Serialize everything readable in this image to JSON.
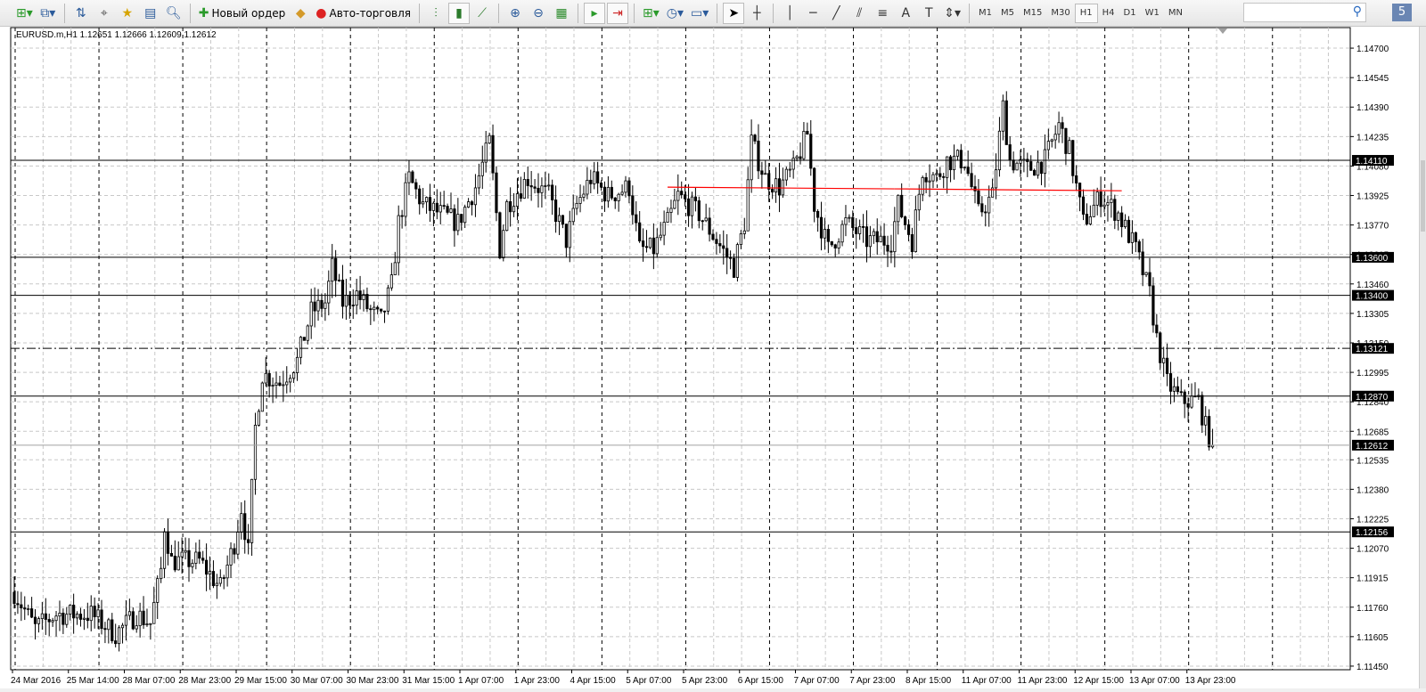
{
  "toolbar": {
    "new_order": "Новый ордер",
    "auto_trading": "Авто-торговля",
    "timeframes": [
      "M1",
      "M5",
      "M15",
      "M30",
      "H1",
      "H4",
      "D1",
      "W1",
      "MN"
    ],
    "active_timeframe": "H1",
    "search_placeholder": "",
    "notifications": "5"
  },
  "chart_info": "EURUSD.m,H1  1.12651 1.12666 1.12609 1.12612",
  "chart_data": {
    "type": "candlestick",
    "symbol": "EURUSD.m",
    "timeframe": "H1",
    "ylim": [
      1.11431,
      1.14808
    ],
    "bars": 344,
    "y_ticks": [
      "1.14700",
      "1.14545",
      "1.14390",
      "1.14235",
      "1.14080",
      "1.13925",
      "1.13770",
      "1.13615",
      "1.13460",
      "1.13305",
      "1.13150",
      "1.12995",
      "1.12840",
      "1.12685",
      "1.12535",
      "1.12380",
      "1.12225",
      "1.12070",
      "1.11915",
      "1.11760",
      "1.11605",
      "1.11450"
    ],
    "x_labels": [
      "24 Mar 2016",
      "25 Mar 14:00",
      "28 Mar 07:00",
      "28 Mar 23:00",
      "29 Mar 15:00",
      "30 Mar 07:00",
      "30 Mar 23:00",
      "31 Mar 15:00",
      "1 Apr 07:00",
      "1 Apr 23:00",
      "4 Apr 15:00",
      "5 Apr 07:00",
      "5 Apr 23:00",
      "6 Apr 15:00",
      "7 Apr 07:00",
      "7 Apr 23:00",
      "8 Apr 15:00",
      "11 Apr 07:00",
      "11 Apr 23:00",
      "12 Apr 15:00",
      "13 Apr 07:00",
      "13 Apr 23:00"
    ],
    "close_path": [
      [
        0,
        1.11839
      ],
      [
        6,
        1.11651
      ],
      [
        12,
        1.11722
      ],
      [
        22,
        1.11722
      ],
      [
        29,
        1.11619
      ],
      [
        35,
        1.11722
      ],
      [
        39,
        1.11675
      ],
      [
        42,
        1.11956
      ],
      [
        43,
        1.1219
      ],
      [
        45,
        1.12003
      ],
      [
        53,
        1.12003
      ],
      [
        59,
        1.11862
      ],
      [
        63,
        1.12096
      ],
      [
        65,
        1.12284
      ],
      [
        67,
        1.12049
      ],
      [
        69,
        1.12705
      ],
      [
        71,
        1.12986
      ],
      [
        76,
        1.12939
      ],
      [
        81,
        1.13056
      ],
      [
        85,
        1.13314
      ],
      [
        89,
        1.13361
      ],
      [
        91,
        1.13548
      ],
      [
        94,
        1.13361
      ],
      [
        98,
        1.13407
      ],
      [
        102,
        1.13314
      ],
      [
        105,
        1.13267
      ],
      [
        108,
        1.13454
      ],
      [
        110,
        1.13782
      ],
      [
        113,
        1.14016
      ],
      [
        117,
        1.13876
      ],
      [
        122,
        1.13829
      ],
      [
        127,
        1.13782
      ],
      [
        132,
        1.13969
      ],
      [
        136,
        1.14204
      ],
      [
        139,
        1.13642
      ],
      [
        141,
        1.13876
      ],
      [
        147,
        1.14016
      ],
      [
        153,
        1.13923
      ],
      [
        158,
        1.13688
      ],
      [
        161,
        1.13876
      ],
      [
        165,
        1.14016
      ],
      [
        170,
        1.13923
      ],
      [
        176,
        1.13969
      ],
      [
        179,
        1.13642
      ],
      [
        183,
        1.13642
      ],
      [
        187,
        1.13782
      ],
      [
        190,
        1.13923
      ],
      [
        196,
        1.13829
      ],
      [
        201,
        1.13688
      ],
      [
        206,
        1.13548
      ],
      [
        209,
        1.13782
      ],
      [
        211,
        1.14204
      ],
      [
        215,
        1.14016
      ],
      [
        219,
        1.13969
      ],
      [
        223,
        1.14063
      ],
      [
        227,
        1.1425
      ],
      [
        229,
        1.13876
      ],
      [
        233,
        1.13642
      ],
      [
        238,
        1.13782
      ],
      [
        244,
        1.13688
      ],
      [
        251,
        1.13688
      ],
      [
        253,
        1.13876
      ],
      [
        257,
        1.13688
      ],
      [
        260,
        1.14063
      ],
      [
        264,
        1.14016
      ],
      [
        267,
        1.1411
      ],
      [
        272,
        1.1411
      ],
      [
        276,
        1.13829
      ],
      [
        280,
        1.13923
      ],
      [
        283,
        1.14391
      ],
      [
        285,
        1.1411
      ],
      [
        290,
        1.14063
      ],
      [
        295,
        1.1411
      ],
      [
        299,
        1.14297
      ],
      [
        302,
        1.14157
      ],
      [
        306,
        1.13782
      ],
      [
        311,
        1.13923
      ],
      [
        316,
        1.13829
      ],
      [
        321,
        1.13642
      ],
      [
        325,
        1.13407
      ],
      [
        327,
        1.13173
      ],
      [
        330,
        1.12939
      ],
      [
        334,
        1.12846
      ],
      [
        339,
        1.12846
      ],
      [
        341,
        1.12705
      ],
      [
        343,
        1.12612
      ]
    ],
    "horizontal_lines": [
      {
        "price": 1.1411,
        "label": "1.14110",
        "style": "solid"
      },
      {
        "price": 1.136,
        "label": "1.13600",
        "style": "solid"
      },
      {
        "price": 1.134,
        "label": "1.13400",
        "style": "solid"
      },
      {
        "price": 1.13121,
        "label": "1.13121",
        "style": "dashdot"
      },
      {
        "price": 1.1287,
        "label": "1.12870",
        "style": "solid"
      },
      {
        "price": 1.12612,
        "label": "1.12612",
        "style": "bid"
      },
      {
        "price": 1.12156,
        "label": "1.12156",
        "style": "solid"
      }
    ],
    "trend_lines": [
      {
        "from": [
          187,
          1.13969
        ],
        "to": [
          252,
          1.1396
        ],
        "color": "#ff0000"
      },
      {
        "from": [
          252,
          1.1396
        ],
        "to": [
          317,
          1.1395
        ],
        "color": "#ff0000"
      }
    ]
  }
}
